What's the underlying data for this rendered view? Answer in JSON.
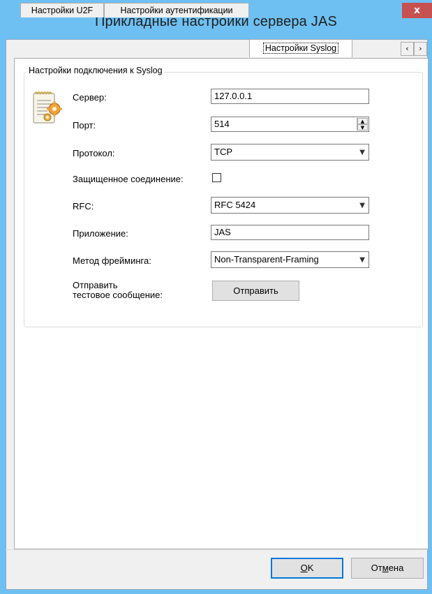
{
  "window": {
    "title": "Прикладные настройки сервера JAS",
    "close_label": "x"
  },
  "tabs": [
    {
      "label": "Настройки U2F"
    },
    {
      "label": "Настройки аутентификации"
    },
    {
      "label": "Настройки Syslog",
      "active": true
    }
  ],
  "tab_scroll": {
    "left": "‹",
    "right": "›"
  },
  "group": {
    "title": "Настройки подключения к Syslog"
  },
  "form": {
    "server_label": "Сервер:",
    "server_value": "127.0.0.1",
    "port_label": "Порт:",
    "port_value": "514",
    "protocol_label": "Протокол:",
    "protocol_value": "TCP",
    "secure_label": "Защищенное соединение:",
    "secure_checked": false,
    "rfc_label": "RFC:",
    "rfc_value": "RFC 5424",
    "app_label": "Приложение:",
    "app_value": "JAS",
    "framing_label": "Метод фрейминга:",
    "framing_value": "Non-Transparent-Framing",
    "send_label_line1": "Отправить",
    "send_label_line2": "тестовое сообщение:",
    "send_button": "Отправить"
  },
  "footer": {
    "ok_prefix": "",
    "ok_u": "O",
    "ok_rest": "K",
    "cancel_prefix": "От",
    "cancel_u": "м",
    "cancel_rest": "ена"
  },
  "icons": {
    "settings": "notepad-gear-icon",
    "combo_arrow": "chevron-down-icon"
  }
}
